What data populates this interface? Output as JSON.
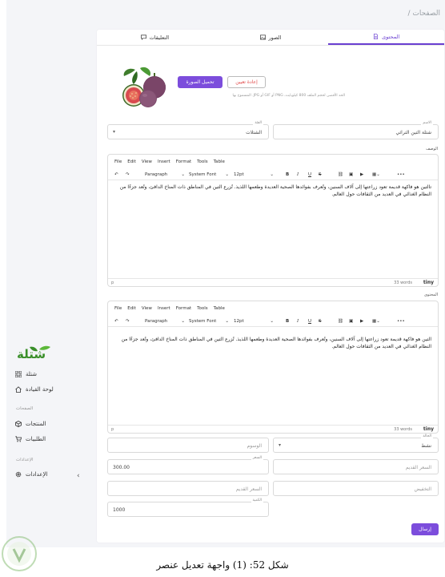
{
  "breadcrumb": "الصفحات /",
  "sidebar": {
    "brand": "شتلة",
    "items": [
      {
        "label": "شتلة",
        "icon": "grid-icon"
      },
      {
        "label": "لوحة القيادة",
        "icon": "home-icon"
      }
    ],
    "section_pages": "الصفحات",
    "page_items": [
      {
        "label": "المنتجات",
        "icon": "cube-icon"
      },
      {
        "label": "الطلبيات",
        "icon": "cart-icon"
      }
    ],
    "section_settings": "الإعدادات",
    "settings_item": {
      "label": "الإعدادات",
      "icon": "gear-icon"
    }
  },
  "tabs": [
    {
      "label": "التعليقات",
      "icon": "comment-icon"
    },
    {
      "label": "الصور",
      "icon": "images-icon"
    },
    {
      "label": "المحتوى",
      "icon": "document-icon",
      "active": true
    }
  ],
  "image_section": {
    "upload_label": "تحميل الصورة",
    "reset_label": "إعادة تعيين",
    "hint": "الحد الأقصى لحجم الملف 800 كيلوبايت، PNG أو GIF أو JPG. المسموح بها"
  },
  "fields": {
    "name": {
      "label": "الاسم",
      "value": "شتلة التين التراثي"
    },
    "category": {
      "label": "الفئة",
      "value": "الشتلات"
    },
    "tags": {
      "placeholder": "الوسوم"
    },
    "status": {
      "label": "الحالة",
      "value": "نشط"
    },
    "price": {
      "label": "السعر",
      "value": "300.00"
    },
    "old_price_1": {
      "placeholder": "السعر القديم"
    },
    "old_price_2": {
      "placeholder": "السعر القديم"
    },
    "discount": {
      "placeholder": "التخفيض"
    },
    "quantity": {
      "label": "الكمية",
      "value": "1000"
    }
  },
  "description_label": "الوصف",
  "content_label": "المحتوى",
  "editor": {
    "menu": [
      "File",
      "Edit",
      "View",
      "Insert",
      "Format",
      "Tools",
      "Table"
    ],
    "block_format": "Paragraph",
    "font_family": "System Font",
    "font_size": "12pt",
    "status_p": "p",
    "word_count": "33 words",
    "brand": "tiny"
  },
  "description_text": "تالتين هو فاكهة قديمة تعود زراعتها إلى آلاف السنين، وتُعرف بفوائدها الصحية العديدة وطعمها اللذيذ. تُزرع التين في المناطق ذات المناخ الدافئ، وتُعد جزءًا من النظام الغذائي في العديد من الثقافات حول العالم.",
  "content_text": "التين هو فاكهة قديمة تعود زراعتها إلى آلاف السنين، وتُعرف بفوائدها الصحية العديدة وطعمها اللذيذ. تُزرع التين في المناطق ذات المناخ الدافئ، وتُعد جزءًا من النظام الغذائي في العديد من الثقافات حول العالم.",
  "submit_label": "إرسال",
  "caption": "شكل 52: (1) واجهة تعديل عنصر",
  "colors": {
    "accent": "#7c4ddc",
    "danger": "#e04747"
  }
}
